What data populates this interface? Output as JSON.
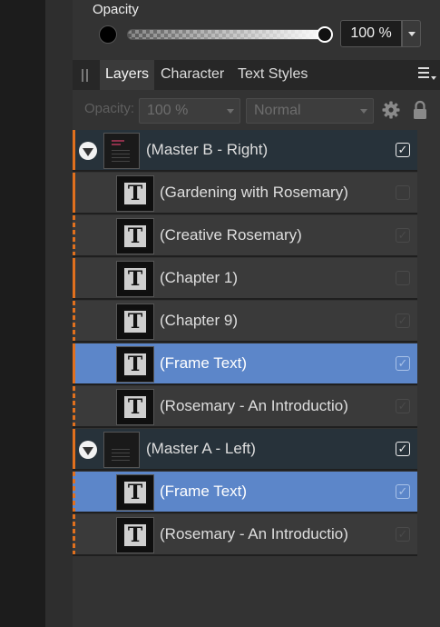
{
  "opacity": {
    "label": "Opacity",
    "value": "100 %",
    "level": 1.0
  },
  "tabs": [
    {
      "label": "Layers",
      "active": true
    },
    {
      "label": "Character",
      "active": false
    },
    {
      "label": "Text Styles",
      "active": false
    }
  ],
  "toolbar": {
    "opacity_label": "Opacity:",
    "opacity_value": "100 %",
    "blend_mode": "Normal"
  },
  "layers": [
    {
      "name": "(Master B - Right)",
      "type": "master",
      "visible": true,
      "selected": false
    },
    {
      "name": "(Gardening with Rosemary)",
      "type": "text",
      "visible": false,
      "selected": false,
      "marker": "solid"
    },
    {
      "name": "(Creative Rosemary)",
      "type": "text",
      "visible": true,
      "selected": false,
      "marker": "dashed"
    },
    {
      "name": "(Chapter 1)",
      "type": "text",
      "visible": false,
      "selected": false,
      "marker": "solid"
    },
    {
      "name": "(Chapter 9)",
      "type": "text",
      "visible": true,
      "selected": false,
      "marker": "dashed"
    },
    {
      "name": "(Frame Text)",
      "type": "text",
      "visible": true,
      "selected": true,
      "marker": "solid"
    },
    {
      "name": "(Rosemary - An Introductio)",
      "type": "text",
      "visible": true,
      "selected": false,
      "marker": "dashed"
    },
    {
      "name": "(Master A - Left)",
      "type": "master",
      "visible": true,
      "selected": false
    },
    {
      "name": "(Frame Text)",
      "type": "text",
      "visible": true,
      "selected": true,
      "marker": "dashed"
    },
    {
      "name": "(Rosemary - An Introductio)",
      "type": "text",
      "visible": true,
      "selected": false,
      "marker": "dashed"
    }
  ],
  "icons": {
    "text_thumb": "T",
    "check": "✓"
  },
  "colors": {
    "accent_orange": "#e0701e",
    "selection_blue": "#5c86c9",
    "master_row": "#27323a"
  }
}
